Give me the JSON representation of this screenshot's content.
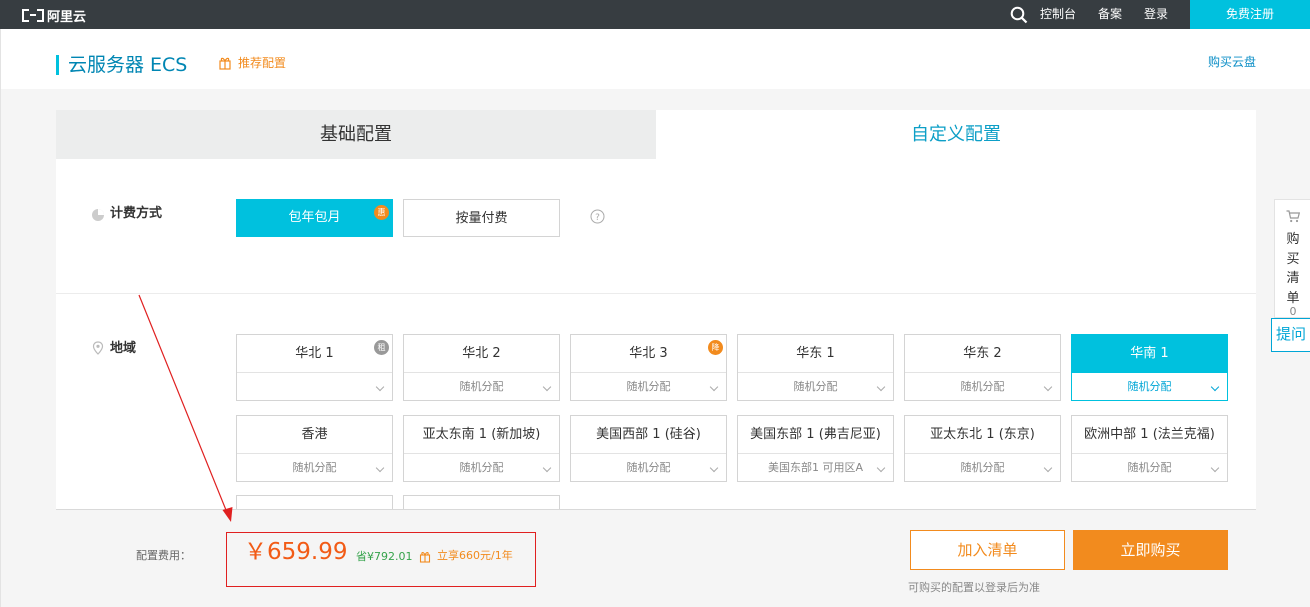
{
  "topbar": {
    "logo_text": "阿里云",
    "console": "控制台",
    "beian": "备案",
    "login": "登录",
    "register": "免费注册"
  },
  "header": {
    "title": "云服务器 ECS",
    "recommend": "推荐配置",
    "buy_disk": "购买云盘"
  },
  "tabs": {
    "basic": "基础配置",
    "custom": "自定义配置"
  },
  "billing": {
    "label": "计费方式",
    "yearly": "包年包月",
    "yearly_badge": "惠",
    "usage": "按量付费"
  },
  "region": {
    "label": "地域",
    "items": [
      {
        "name": "华北 1",
        "zone": "",
        "badge": "租"
      },
      {
        "name": "华北 2",
        "zone": "随机分配"
      },
      {
        "name": "华北 3",
        "zone": "随机分配",
        "badge": "降"
      },
      {
        "name": "华东 1",
        "zone": "随机分配"
      },
      {
        "name": "华东 2",
        "zone": "随机分配"
      },
      {
        "name": "华南 1",
        "zone": "随机分配",
        "selected": true
      },
      {
        "name": "香港",
        "zone": "随机分配"
      },
      {
        "name": "亚太东南 1 (新加坡)",
        "zone": "随机分配"
      },
      {
        "name": "美国西部 1 (硅谷)",
        "zone": "随机分配"
      },
      {
        "name": "美国东部 1 (弗吉尼亚)",
        "zone": "美国东部1 可用区A"
      },
      {
        "name": "亚太东北 1 (东京)",
        "zone": "随机分配"
      },
      {
        "name": "欧洲中部 1 (法兰克福)",
        "zone": "随机分配"
      }
    ]
  },
  "footer": {
    "fee_label": "配置费用：",
    "price": "￥659.99",
    "save": "省¥792.01",
    "promo": "立享660元/1年",
    "add_cart": "加入清单",
    "buy_now": "立即购买",
    "note": "可购买的配置以登录后为准"
  },
  "float": {
    "cart_chars": [
      "购",
      "买",
      "清",
      "单"
    ],
    "cart_count": "0",
    "ask": "提问"
  },
  "colors": {
    "topbar": "#373d41",
    "accent": "#00c1de",
    "orange": "#f28b1e",
    "price": "#f25b16",
    "annotation": "#e02020"
  }
}
